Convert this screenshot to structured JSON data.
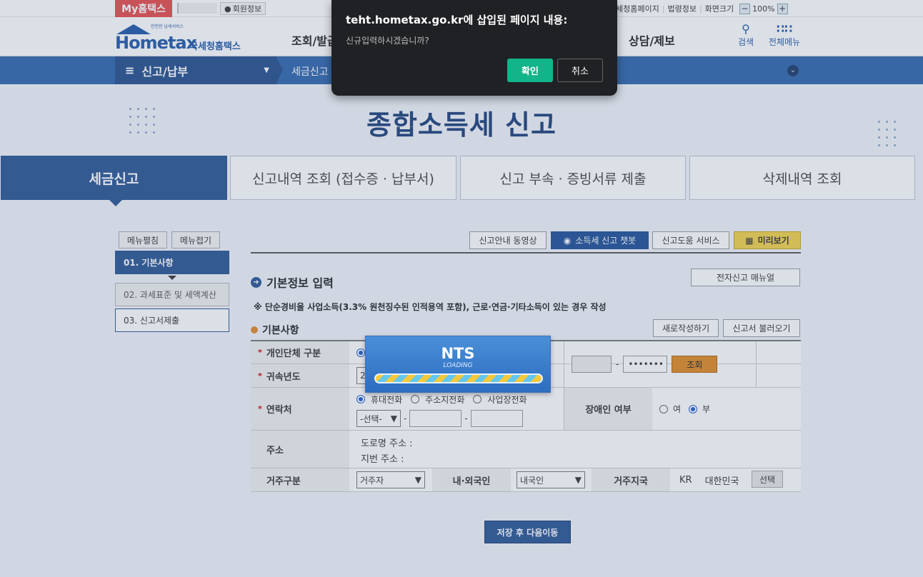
{
  "topbar": {
    "my_tab": "My홈택스",
    "member_info": "회원정보",
    "links": [
      "세청홈페이지",
      "법령정보",
      "화면크기"
    ],
    "zoom_minus": "−",
    "zoom_value": "100%",
    "zoom_plus": "+"
  },
  "header": {
    "logo_tagline": "안전한 납세서비스",
    "logo_text": "Hometax",
    "logo_kr": "국세청홈택스",
    "gnb": [
      "조회/발급",
      "상담/제보"
    ],
    "search_label": "검색",
    "allmenu_label": "전체메뉴"
  },
  "navbar": {
    "menu_label": "신고/납부",
    "breadcrumb": "세금신고"
  },
  "hero": {
    "title": "종합소득세 신고"
  },
  "tabs": [
    "세금신고",
    "신고내역 조회 (접수증 · 납부서)",
    "신고 부속 · 증빙서류 제출",
    "삭제내역 조회"
  ],
  "sidebar": {
    "edit_menu": "메뉴펼침",
    "collapse_menu": "메뉴접기",
    "items": [
      "01. 기본사항",
      "02. 과세표준 및 세액계산",
      "03. 신고서제출"
    ]
  },
  "toolbar": {
    "video_guide": "신고안내 동영상",
    "chatbot": "소득세 신고 챗봇",
    "help_service": "신고도움 서비스",
    "preview": "미리보기"
  },
  "section": {
    "title": "기본정보 입력",
    "manual_button": "전자신고 매뉴얼",
    "note": "※ 단순경비율 사업소득(3.3% 원천징수된 인적용역 포함), 근로·연금·기타소득이 있는 경우 작성",
    "subtitle": "기본사항",
    "rewrite_button": "새로작성하기",
    "load_button": "신고서 불러오기"
  },
  "form": {
    "person_type_label": "개인단체 구분",
    "year_label": "귀속년도",
    "year_value": "2",
    "id_masked": "•••••••",
    "lookup_button": "조회",
    "contact_label": "연락처",
    "contact_options": [
      "휴대전화",
      "주소지전화",
      "사업장전화"
    ],
    "phone_select": "-선택-",
    "dash": "-",
    "disability_label": "장애인 여부",
    "disability_yes": "여",
    "disability_no": "부",
    "address_label": "주소",
    "road_address": "도로명 주소 :",
    "lot_address": "지번 주소 :",
    "residence_label": "거주구분",
    "residence_value": "거주자",
    "nationality_label": "내·외국인",
    "nationality_value": "내국인",
    "country_label": "거주지국",
    "country_code": "KR",
    "country_name": "대한민국",
    "select_button": "선택"
  },
  "save_next": "저장 후 다음이동",
  "dialog": {
    "title": "teht.hometax.go.kr에 삽입된 페이지 내용:",
    "message": "신규입력하시겠습니까?",
    "ok": "확인",
    "cancel": "취소"
  },
  "loading": {
    "brand": "NTS",
    "text": "LOADING"
  }
}
